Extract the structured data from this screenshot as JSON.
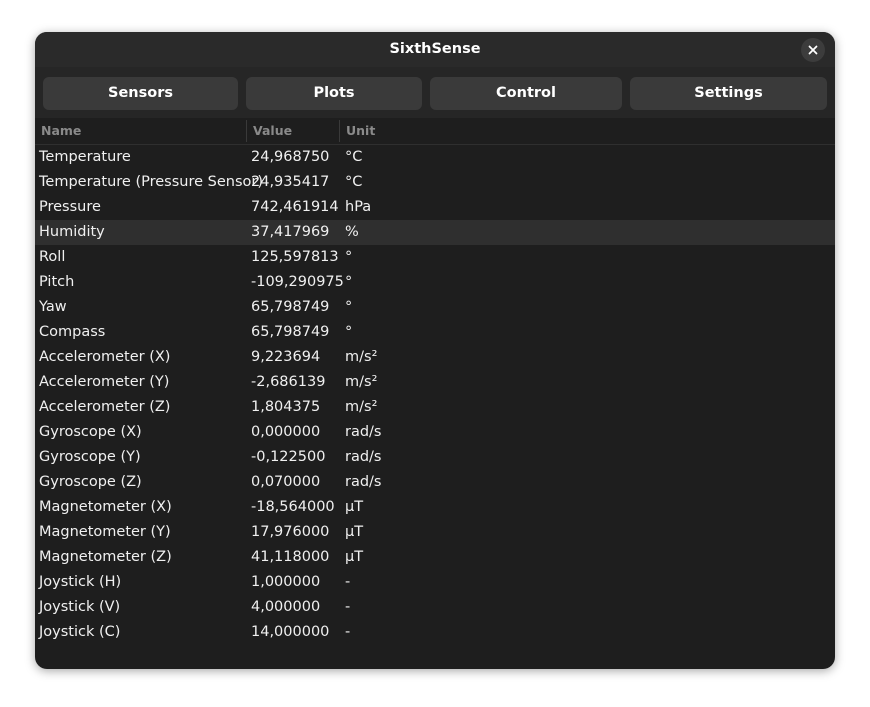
{
  "window": {
    "title": "SixthSense"
  },
  "tabs": [
    {
      "label": "Sensors"
    },
    {
      "label": "Plots"
    },
    {
      "label": "Control"
    },
    {
      "label": "Settings"
    }
  ],
  "table": {
    "columns": [
      "Name",
      "Value",
      "Unit"
    ],
    "selected_row": "Humidity",
    "rows": [
      {
        "name": "Temperature",
        "value": "24,968750",
        "unit": "°C"
      },
      {
        "name": "Temperature (Pressure Sensor)",
        "value": "24,935417",
        "unit": "°C"
      },
      {
        "name": "Pressure",
        "value": "742,461914",
        "unit": "hPa"
      },
      {
        "name": "Humidity",
        "value": "37,417969",
        "unit": "%"
      },
      {
        "name": "Roll",
        "value": "125,597813",
        "unit": "°"
      },
      {
        "name": "Pitch",
        "value": "-109,290975",
        "unit": "°"
      },
      {
        "name": "Yaw",
        "value": "65,798749",
        "unit": "°"
      },
      {
        "name": "Compass",
        "value": "65,798749",
        "unit": "°"
      },
      {
        "name": "Accelerometer (X)",
        "value": "9,223694",
        "unit": "m/s²"
      },
      {
        "name": "Accelerometer (Y)",
        "value": "-2,686139",
        "unit": "m/s²"
      },
      {
        "name": "Accelerometer (Z)",
        "value": "1,804375",
        "unit": "m/s²"
      },
      {
        "name": "Gyroscope (X)",
        "value": "0,000000",
        "unit": "rad/s"
      },
      {
        "name": "Gyroscope (Y)",
        "value": "-0,122500",
        "unit": "rad/s"
      },
      {
        "name": "Gyroscope (Z)",
        "value": "0,070000",
        "unit": "rad/s"
      },
      {
        "name": "Magnetometer (X)",
        "value": "-18,564000",
        "unit": "µT"
      },
      {
        "name": "Magnetometer (Y)",
        "value": "17,976000",
        "unit": "µT"
      },
      {
        "name": "Magnetometer (Z)",
        "value": "41,118000",
        "unit": "µT"
      },
      {
        "name": "Joystick (H)",
        "value": "1,000000",
        "unit": "-"
      },
      {
        "name": "Joystick (V)",
        "value": "4,000000",
        "unit": "-"
      },
      {
        "name": "Joystick (C)",
        "value": "14,000000",
        "unit": "-"
      }
    ]
  },
  "icons": {
    "close": "close-icon"
  },
  "colors": {
    "window_bg": "#1e1e1e",
    "headerbar_bg": "#2a2a2a",
    "button_bg": "#3a3a3a",
    "selected_row_bg": "#2f2f2f",
    "header_text": "#8a8a8a"
  }
}
